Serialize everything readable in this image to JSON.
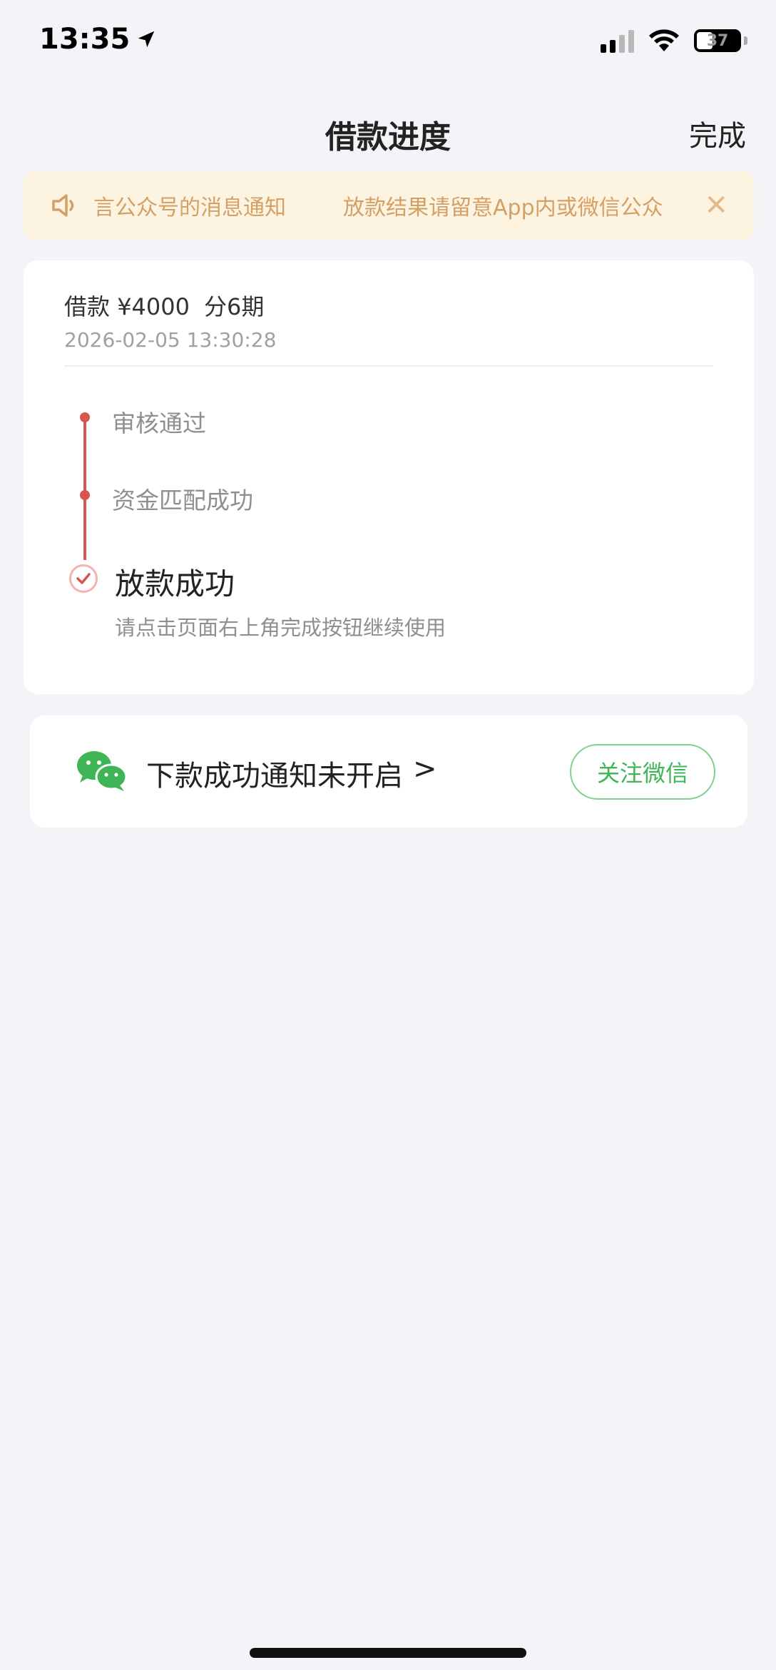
{
  "status_bar": {
    "time": "13:35",
    "battery": "37",
    "location_icon": "location-arrow-icon",
    "signal_icon": "cellular-signal-icon",
    "wifi_icon": "wifi-icon"
  },
  "header": {
    "title": "借款进度",
    "done_label": "完成"
  },
  "notice": {
    "icon": "speaker-icon",
    "text_part1": "言公众号的消息通知",
    "text_part2": "放款结果请留意App内或微信公众",
    "close_icon": "close-icon",
    "colors": {
      "background": "#fdf3e1",
      "text": "#d4a066"
    }
  },
  "loan": {
    "amount_label": "借款",
    "amount": "¥4000",
    "installments": "分6期",
    "timestamp": "2026-02-05 13:30:28"
  },
  "progress": {
    "steps": [
      {
        "label": "审核通过"
      },
      {
        "label": "资金匹配成功"
      }
    ],
    "final": {
      "label": "放款成功",
      "sub": "请点击页面右上角完成按钮继续使用",
      "icon": "check-circle-icon"
    },
    "accent_color": "#d9534f"
  },
  "wechat": {
    "icon": "wechat-icon",
    "text": "下款成功通知未开启",
    "arrow": ">",
    "button_label": "关注微信",
    "accent_color": "#3fb555"
  }
}
